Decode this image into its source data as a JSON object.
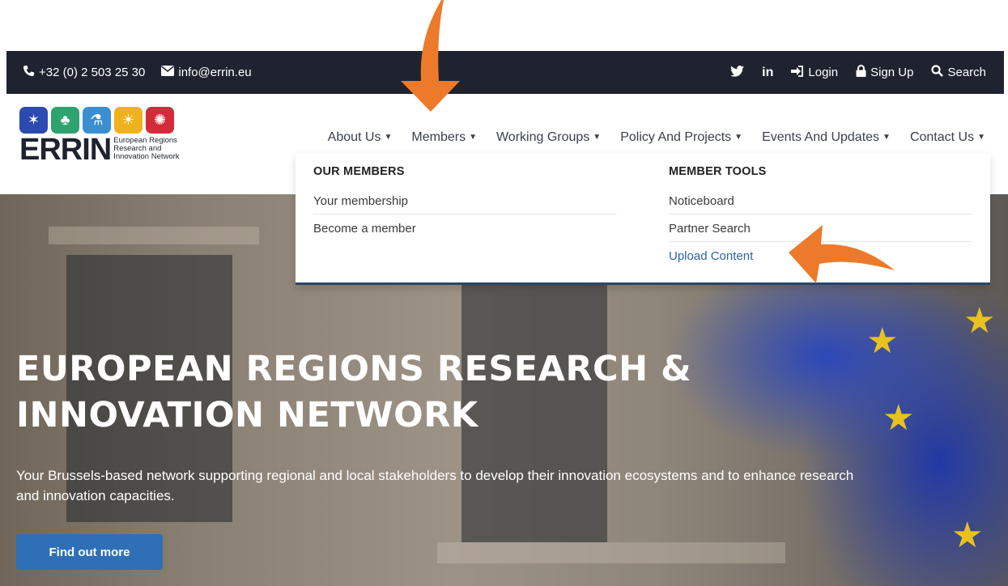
{
  "topbar": {
    "phone": "+32 (0) 2 503 25 30",
    "email": "info@errin.eu",
    "twitter_icon": "twitter-icon",
    "linkedin": "in",
    "login": "Login",
    "signup": "Sign Up",
    "search": "Search"
  },
  "logo": {
    "wordmark": "ERRIN",
    "sub1": "European Regions",
    "sub2": "Research and",
    "sub3": "Innovation Network",
    "cube_colors": [
      "#2b4bb1",
      "#2ea36f",
      "#3a8fd1",
      "#f0b21c",
      "#d42b3a"
    ]
  },
  "nav": {
    "items": [
      "About Us",
      "Members",
      "Working Groups",
      "Policy And Projects",
      "Events And Updates",
      "Contact Us"
    ]
  },
  "dropdown": {
    "col1": {
      "heading": "OUR MEMBERS",
      "links": [
        "Your membership",
        "Become a member"
      ]
    },
    "col2": {
      "heading": "MEMBER TOOLS",
      "links": [
        "Noticeboard",
        "Partner Search",
        "Upload Content"
      ]
    }
  },
  "hero": {
    "title_line1": "EUROPEAN REGIONS RESEARCH &",
    "title_line2": "INNOVATION NETWORK",
    "subtitle": "Your Brussels-based network supporting regional and local stakeholders to develop their innovation ecosystems and to enhance research and innovation capacities.",
    "button": "Find out more"
  },
  "colors": {
    "topbar_bg": "#1f2330",
    "accent_blue": "#2f6fb5",
    "link_highlight": "#2a63a8",
    "arrow_orange": "#ec7a2a"
  }
}
